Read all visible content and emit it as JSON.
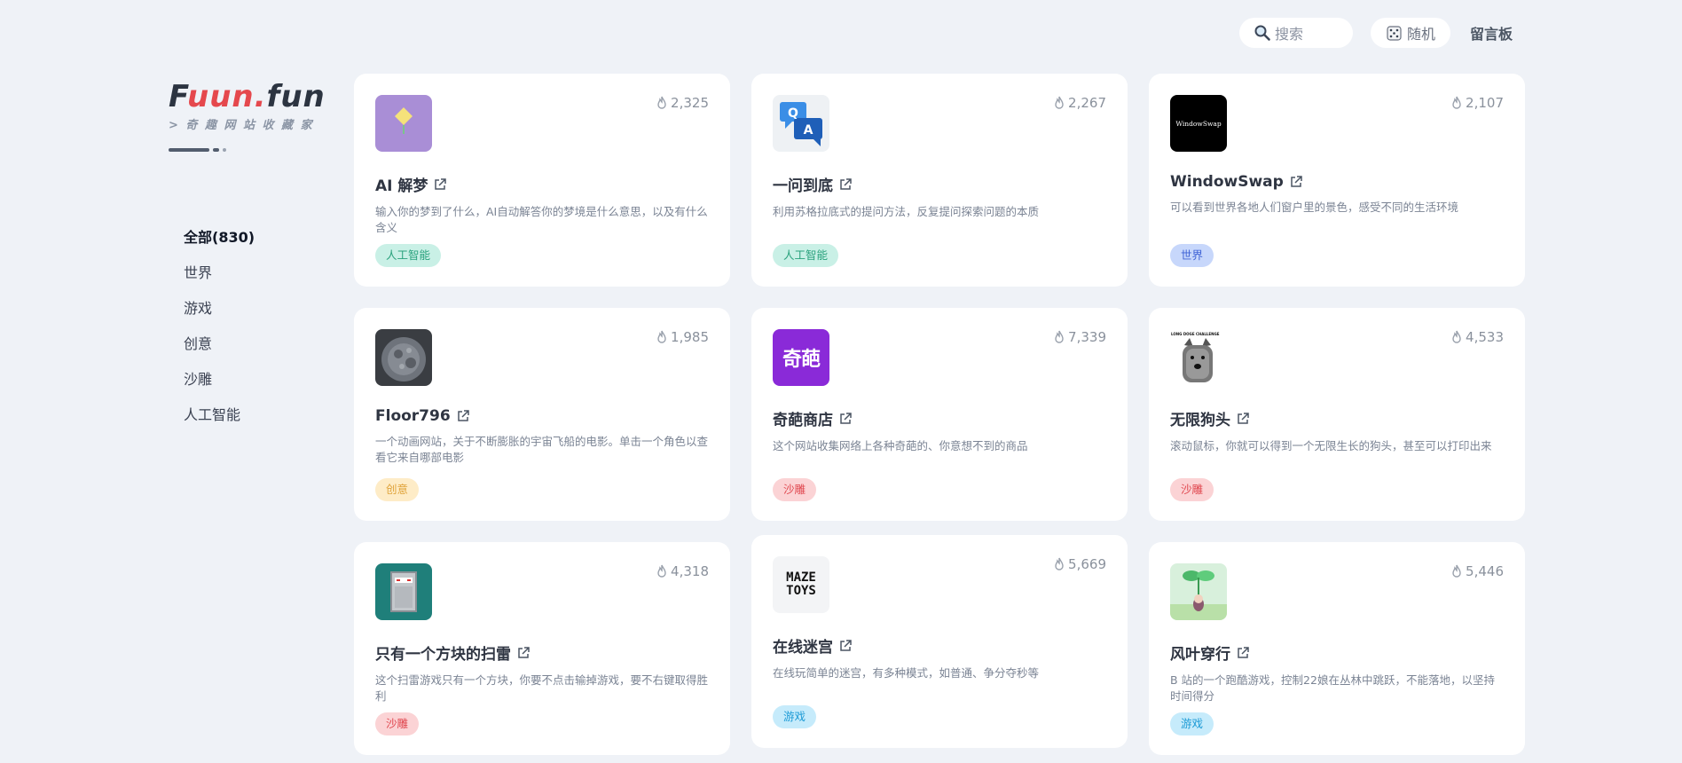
{
  "nav": {
    "search_placeholder": "搜索",
    "random_label": "随机",
    "guestbook_label": "留言板"
  },
  "logo": {
    "part1": "F",
    "part2": "uun",
    "part3": ".",
    "part4": "fun",
    "subtitle": "> 奇 趣 网 站 收 藏 家"
  },
  "categories": [
    {
      "label": "全部(830)",
      "active": true
    },
    {
      "label": "世界"
    },
    {
      "label": "游戏"
    },
    {
      "label": "创意"
    },
    {
      "label": "沙雕"
    },
    {
      "label": "人工智能"
    }
  ],
  "colors": {
    "tag_ai_bg": "#c9f0e6",
    "tag_ai_fg": "#2aa27d",
    "tag_world_bg": "#c7d7fb",
    "tag_world_fg": "#3f63d6",
    "tag_creative_bg": "#feecc7",
    "tag_creative_fg": "#e0a33a",
    "tag_silly_bg": "#fbd3d5",
    "tag_silly_fg": "#e0474f",
    "tag_game_bg": "#c6ebfb",
    "tag_game_fg": "#1d9bd6"
  },
  "cards": [
    {
      "title": "AI 解梦",
      "heat": "2,325",
      "desc": "输入你的梦到了什么，AI自动解答你的梦境是什么意思，以及有什么含义",
      "tag": "人工智能",
      "icon": "flower-dream-icon"
    },
    {
      "title": "一问到底",
      "heat": "2,267",
      "desc": "利用苏格拉底式的提问方法，反复提问探索问题的本质",
      "tag": "人工智能",
      "icon": "qa-bubbles-icon"
    },
    {
      "title": "WindowSwap",
      "heat": "2,107",
      "desc": "可以看到世界各地人们窗户里的景色，感受不同的生活环境",
      "tag": "世界",
      "icon": "windowswap-logo",
      "thumb_text": "WindowSwap"
    },
    {
      "title": "Floor796",
      "heat": "1,985",
      "desc": "一个动画网站，关于不断膨胀的宇宙飞船的电影。单击一个角色以查看它来自哪部电影",
      "tag": "创意",
      "icon": "space-station-icon"
    },
    {
      "title": "奇葩商店",
      "heat": "7,339",
      "desc": "这个网站收集网络上各种奇葩的、你意想不到的商品",
      "tag": "沙雕",
      "icon": "weird-shop-logo",
      "thumb_text": "奇葩"
    },
    {
      "title": "无限狗头",
      "heat": "4,533",
      "desc": "滚动鼠标，你就可以得到一个无限生长的狗头，甚至可以打印出来",
      "tag": "沙雕",
      "icon": "long-doge-icon",
      "thumb_text": "LONG DOGE CHALLENGE"
    },
    {
      "title": "只有一个方块的扫雷",
      "heat": "4,318",
      "desc": "这个扫雷游戏只有一个方块，你要不点击输掉游戏，要不右键取得胜利",
      "tag": "沙雕",
      "icon": "minesweeper-icon"
    },
    {
      "title": "在线迷宫",
      "heat": "5,669",
      "desc": "在线玩简单的迷宫，有多种模式，如普通、争分夺秒等",
      "tag": "游戏",
      "icon": "maze-toys-logo",
      "thumb_text": "MAZE TOYS"
    },
    {
      "title": "风叶穿行",
      "heat": "5,446",
      "desc": "B 站的一个跑酷游戏，控制22娘在丛林中跳跃，不能落地，以坚持时间得分",
      "tag": "游戏",
      "icon": "leaf-character-icon"
    }
  ]
}
